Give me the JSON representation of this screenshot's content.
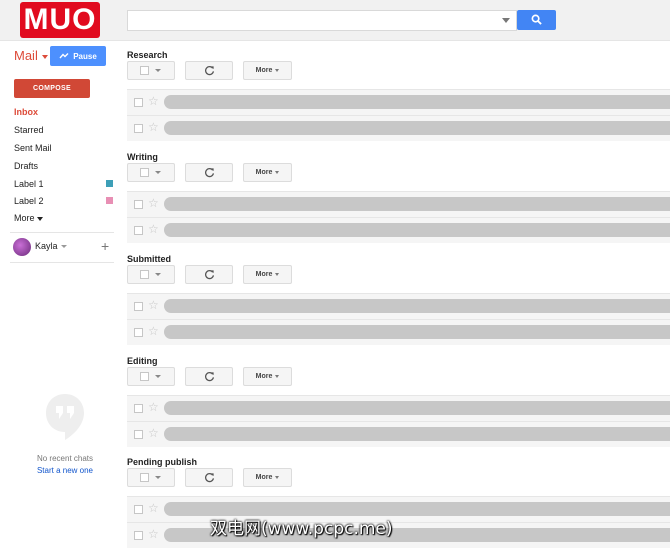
{
  "brand": {
    "logo_text": "MUO",
    "logo_color": "#e10b1f"
  },
  "search": {
    "value": "",
    "button_color": "#4285f4"
  },
  "left_nav": {
    "mail_label": "Mail",
    "pause_label": "Pause",
    "compose_label": "COMPOSE",
    "items": [
      {
        "label": "Inbox",
        "active": true
      },
      {
        "label": "Starred"
      },
      {
        "label": "Sent Mail"
      },
      {
        "label": "Drafts"
      },
      {
        "label": "Label 1",
        "swatch": "#3d9fb7"
      },
      {
        "label": "Label 2",
        "swatch": "#e88fb4"
      },
      {
        "label": "More"
      }
    ],
    "user": {
      "name": "Kayla"
    },
    "chat": {
      "no_chats": "No recent chats",
      "start_new": "Start a new one"
    }
  },
  "toolbar": {
    "more_label": "More"
  },
  "sections": [
    {
      "title": "Research"
    },
    {
      "title": "Writing"
    },
    {
      "title": "Submitted"
    },
    {
      "title": "Editing"
    },
    {
      "title": "Pending publish"
    }
  ],
  "watermark": "双电网(www.pcpc.me)"
}
